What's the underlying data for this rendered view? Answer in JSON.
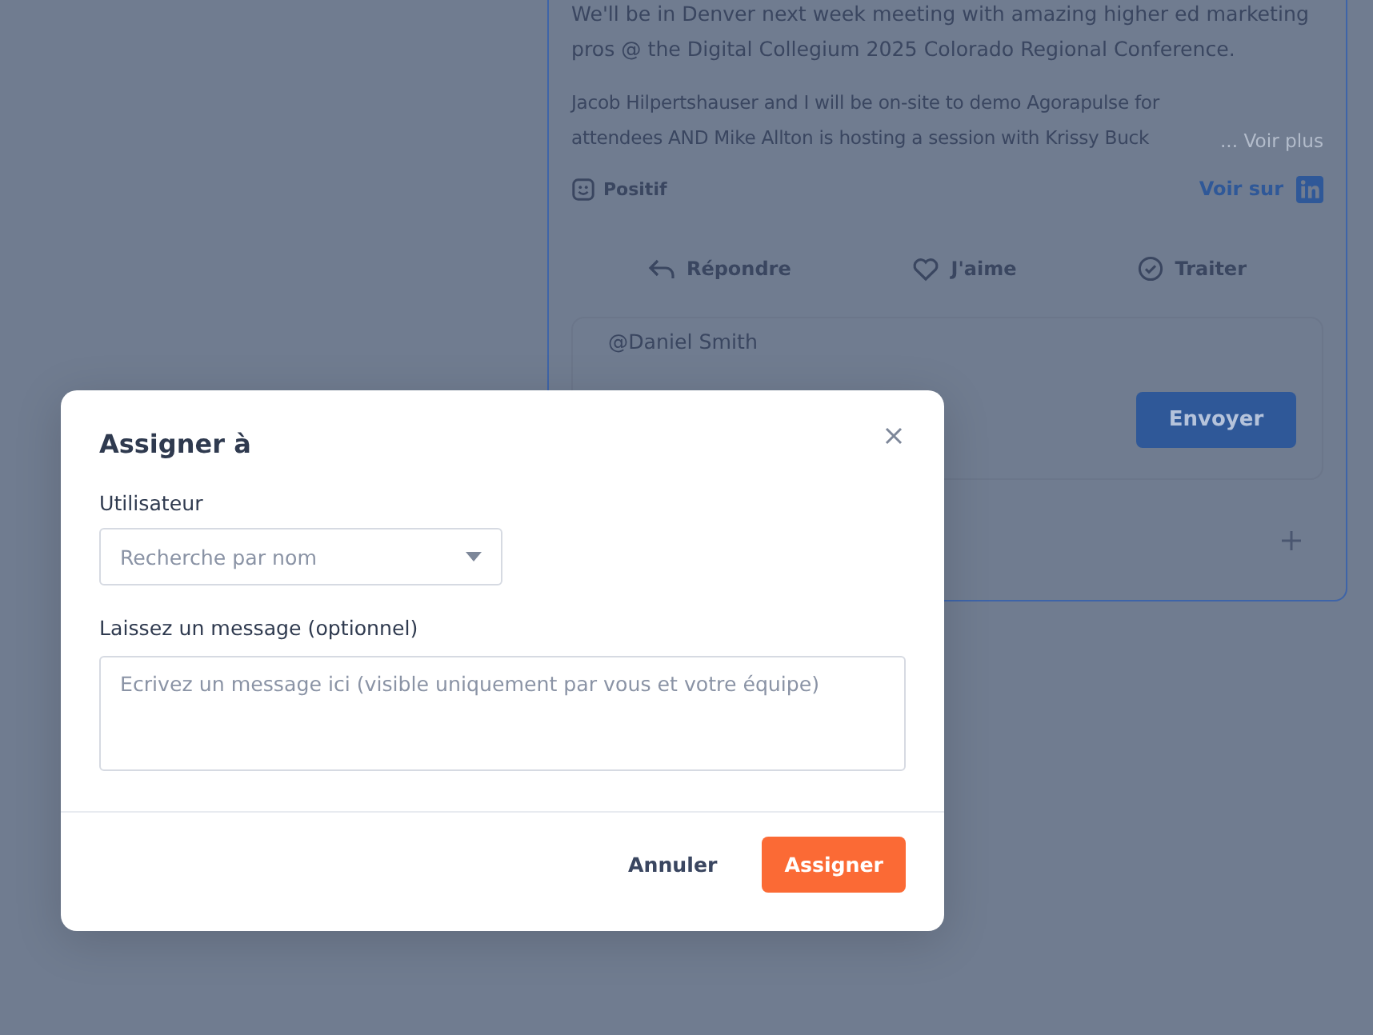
{
  "post": {
    "paragraphs": [
      "We'll be in Denver next week meeting with amazing higher ed marketing pros @ the Digital Collegium 2025 Colorado Regional Conference.",
      "Jacob Hilpertshauser and I will be on-site to demo Agorapulse for attendees AND Mike Allton is hosting a session with Krissy Buck"
    ],
    "see_more": "... Voir plus",
    "sentiment": "Positif",
    "view_on": "Voir sur"
  },
  "actions": [
    {
      "kind": "reply",
      "label": "Répondre"
    },
    {
      "kind": "like",
      "label": "J'aime"
    },
    {
      "kind": "done",
      "label": "Traiter"
    }
  ],
  "reply_box": {
    "value": "@Daniel Smith",
    "send": "Envoyer"
  },
  "modal": {
    "title": "Assigner à",
    "user_label": "Utilisateur",
    "user_placeholder": "Recherche par nom",
    "message_label": "Laissez un message (optionnel)",
    "message_placeholder": "Ecrivez un message ici (visible uniquement par vous et votre équipe)",
    "cancel": "Annuler",
    "confirm": "Assigner"
  }
}
